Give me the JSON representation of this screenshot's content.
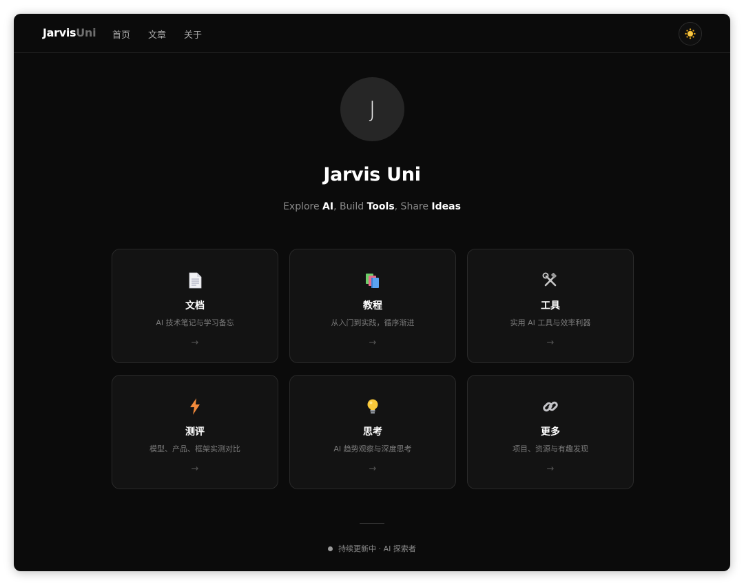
{
  "nav": {
    "brand_main": "Jarvis",
    "brand_accent": "Uni",
    "links": [
      "首页",
      "文章",
      "关于"
    ],
    "theme_icon": "sun-icon"
  },
  "hero": {
    "avatar_letter": "J",
    "title": "Jarvis Uni",
    "tagline": {
      "w1": "Explore ",
      "b1": "AI",
      "w2": ", Build ",
      "b2": "Tools",
      "w3": ", Share ",
      "b3": "Ideas"
    }
  },
  "cards": [
    {
      "title": "文档",
      "desc": "AI 技术笔记与学习备忘",
      "arrow": "→",
      "icon": "document-icon"
    },
    {
      "title": "教程",
      "desc": "从入门到实践，循序渐进",
      "arrow": "→",
      "icon": "books-icon"
    },
    {
      "title": "工具",
      "desc": "实用 AI 工具与效率利器",
      "arrow": "→",
      "icon": "tools-icon"
    },
    {
      "title": "测评",
      "desc": "模型、产品、框架实测对比",
      "arrow": "→",
      "icon": "lightning-icon"
    },
    {
      "title": "思考",
      "desc": "AI 趋势观察与深度思考",
      "arrow": "→",
      "icon": "lightbulb-icon"
    },
    {
      "title": "更多",
      "desc": "项目、资源与有趣发现",
      "arrow": "→",
      "icon": "link-icon"
    }
  ],
  "footer": {
    "text": "持续更新中 · AI 探索者"
  }
}
